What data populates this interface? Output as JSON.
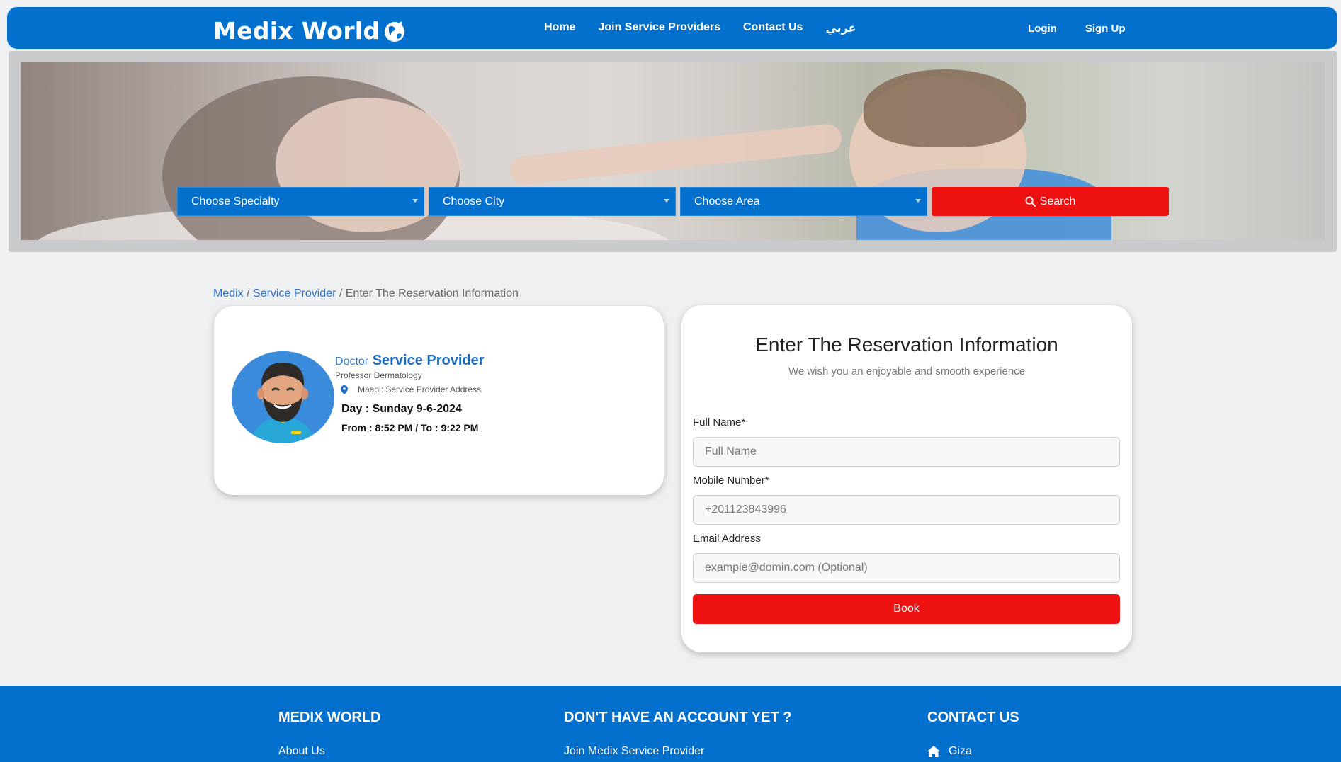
{
  "nav": {
    "logo": "Medix World",
    "links": [
      "Home",
      "Join Service Providers",
      "Contact Us",
      "عربي"
    ],
    "login": "Login",
    "signup": "Sign Up"
  },
  "search": {
    "specialty": "Choose Specialty",
    "city": "Choose City",
    "area": "Choose Area",
    "button": "Search"
  },
  "breadcrumb": {
    "home": "Medix",
    "sep1": " / ",
    "provider": "Service Provider",
    "sep2": " / ",
    "current": "Enter The Reservation Information"
  },
  "provider": {
    "prefix": "Doctor",
    "name": "Service Provider",
    "specialty": "Professor Dermatology",
    "address": "Maadi: Service Provider Address",
    "day": "Day : Sunday 9-6-2024",
    "time": "From : 8:52 PM / To : 9:22 PM"
  },
  "form": {
    "title": "Enter The Reservation Information",
    "subtitle": "We wish you an enjoyable and smooth experience",
    "full_name_label": "Full Name*",
    "full_name_placeholder": "Full Name",
    "mobile_label": "Mobile Number*",
    "mobile_placeholder": "+201123843996",
    "email_label": "Email Address",
    "email_placeholder": "example@domin.com (Optional)",
    "book": "Book"
  },
  "footer": {
    "col1_title": "MEDIX WORLD",
    "col1_link": "About Us",
    "col2_title": "DON'T HAVE AN ACCOUNT YET ?",
    "col2_link": "Join Medix Service Provider",
    "col3_title": "CONTACT US",
    "col3_link": "Giza"
  },
  "colors": {
    "brand_blue": "#0270cc",
    "action_red": "#ee1111",
    "page_bg": "#eef0f2"
  }
}
